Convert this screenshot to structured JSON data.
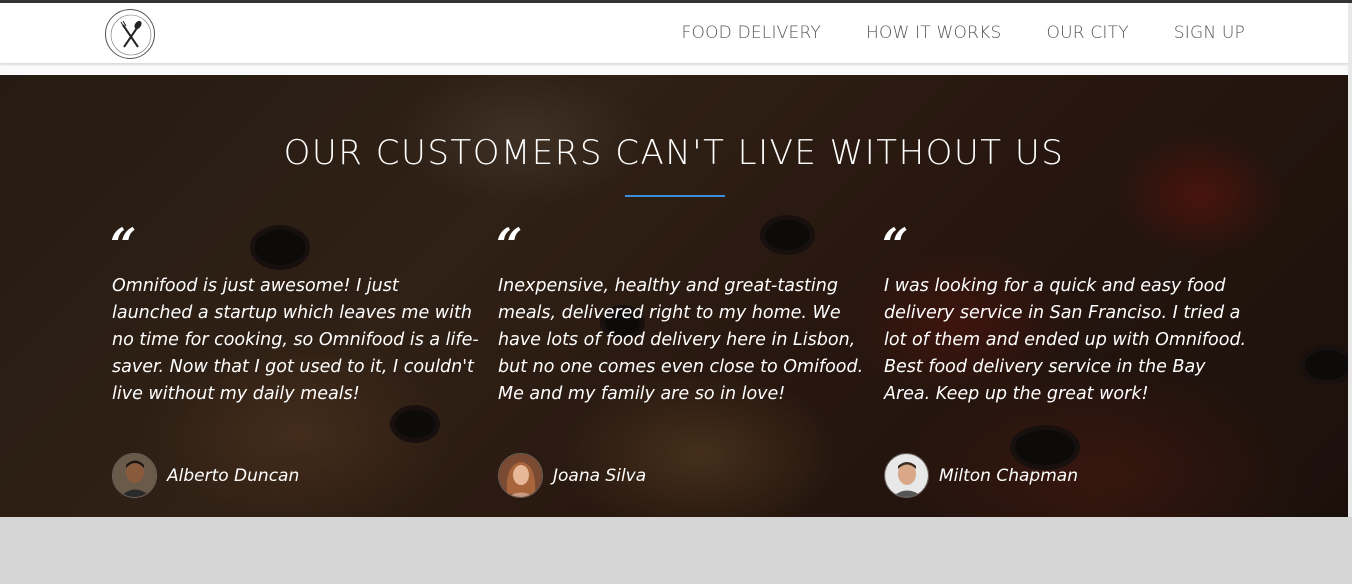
{
  "nav": {
    "items": [
      {
        "label": "FOOD DELIVERY"
      },
      {
        "label": "HOW IT WORKS"
      },
      {
        "label": "OUR CITY"
      },
      {
        "label": "SIGN UP"
      }
    ]
  },
  "logo": {
    "icon": "fork-spoon-logo-icon"
  },
  "testimonials": {
    "title": "OUR CUSTOMERS CAN'T LIVE WITHOUT US",
    "underline_color": "#3b8fd8",
    "quote_mark": "“",
    "items": [
      {
        "text": "Omnifood is just awesome! I just launched a startup which leaves me with no time for cooking, so Omnifood is a life-saver. Now that I got used to it, I couldn't live without my daily meals!",
        "author": "Alberto Duncan"
      },
      {
        "text": "Inexpensive, healthy and great-tasting meals, delivered right to my home. We have lots of food delivery here in Lisbon, but no one comes even close to Omifood. Me and my family are so in love!",
        "author": "Joana Silva"
      },
      {
        "text": "I was looking for a quick and easy food delivery service in San Franciso. I tried a lot of them and ended up with Omnifood. Best food delivery service in the Bay Area. Keep up the great work!",
        "author": "Milton Chapman"
      }
    ]
  }
}
